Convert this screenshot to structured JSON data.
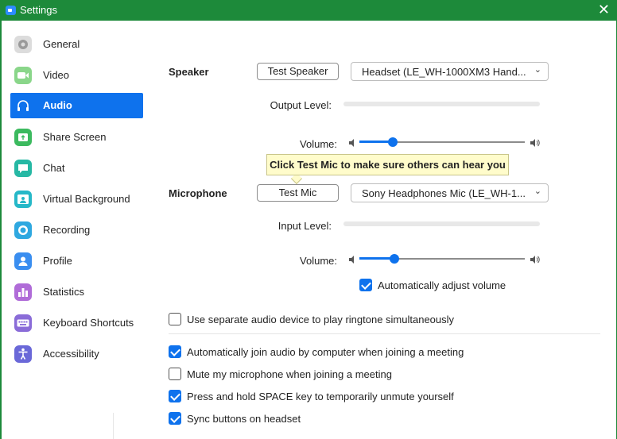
{
  "window": {
    "title": "Settings",
    "close_glyph": "✕"
  },
  "sidebar": {
    "items": [
      {
        "label": "General",
        "icon": "gear-icon",
        "color": "#c8c8c8",
        "active": false
      },
      {
        "label": "Video",
        "icon": "video-camera-icon",
        "color": "#6cc86c",
        "active": false
      },
      {
        "label": "Audio",
        "icon": "headphones-icon",
        "color": "#0e72ed",
        "active": true
      },
      {
        "label": "Share Screen",
        "icon": "share-screen-icon",
        "color": "#3cba5f",
        "active": false
      },
      {
        "label": "Chat",
        "icon": "chat-bubble-icon",
        "color": "#26b8a4",
        "active": false
      },
      {
        "label": "Virtual Background",
        "icon": "virtual-background-icon",
        "color": "#26b8c8",
        "active": false
      },
      {
        "label": "Recording",
        "icon": "record-icon",
        "color": "#2fa8e0",
        "active": false
      },
      {
        "label": "Profile",
        "icon": "profile-icon",
        "color": "#3a8ef0",
        "active": false
      },
      {
        "label": "Statistics",
        "icon": "statistics-icon",
        "color": "#b06cd8",
        "active": false
      },
      {
        "label": "Keyboard Shortcuts",
        "icon": "keyboard-icon",
        "color": "#8a6cd8",
        "active": false
      },
      {
        "label": "Accessibility",
        "icon": "accessibility-icon",
        "color": "#6a68d8",
        "active": false
      }
    ]
  },
  "speaker": {
    "label": "Speaker",
    "test_button": "Test Speaker",
    "device": "Headset (LE_WH-1000XM3 Hand...",
    "output_level_label": "Output Level:",
    "volume_label": "Volume:",
    "volume_fraction": 0.2
  },
  "tooltip": {
    "text": "Click Test Mic to make sure others can hear you"
  },
  "microphone": {
    "label": "Microphone",
    "test_button": "Test Mic",
    "device": "Sony Headphones Mic (LE_WH-1...",
    "input_level_label": "Input Level:",
    "volume_label": "Volume:",
    "volume_fraction": 0.21,
    "auto_adjust": {
      "label": "Automatically adjust volume",
      "checked": true
    }
  },
  "options": {
    "separate_device": {
      "label": "Use separate audio device to play ringtone simultaneously",
      "checked": false
    },
    "auto_join": {
      "label": "Automatically join audio by computer when joining a meeting",
      "checked": true
    },
    "mute_mic": {
      "label": "Mute my microphone when joining a meeting",
      "checked": false
    },
    "space_unmute": {
      "label": "Press and hold SPACE key to temporarily unmute yourself",
      "checked": true
    },
    "sync_buttons": {
      "label": "Sync buttons on headset",
      "checked": true
    }
  },
  "colors": {
    "accent": "#0e72ed",
    "titlebar": "#1d8a3a",
    "tooltip_bg": "#fffccb"
  }
}
